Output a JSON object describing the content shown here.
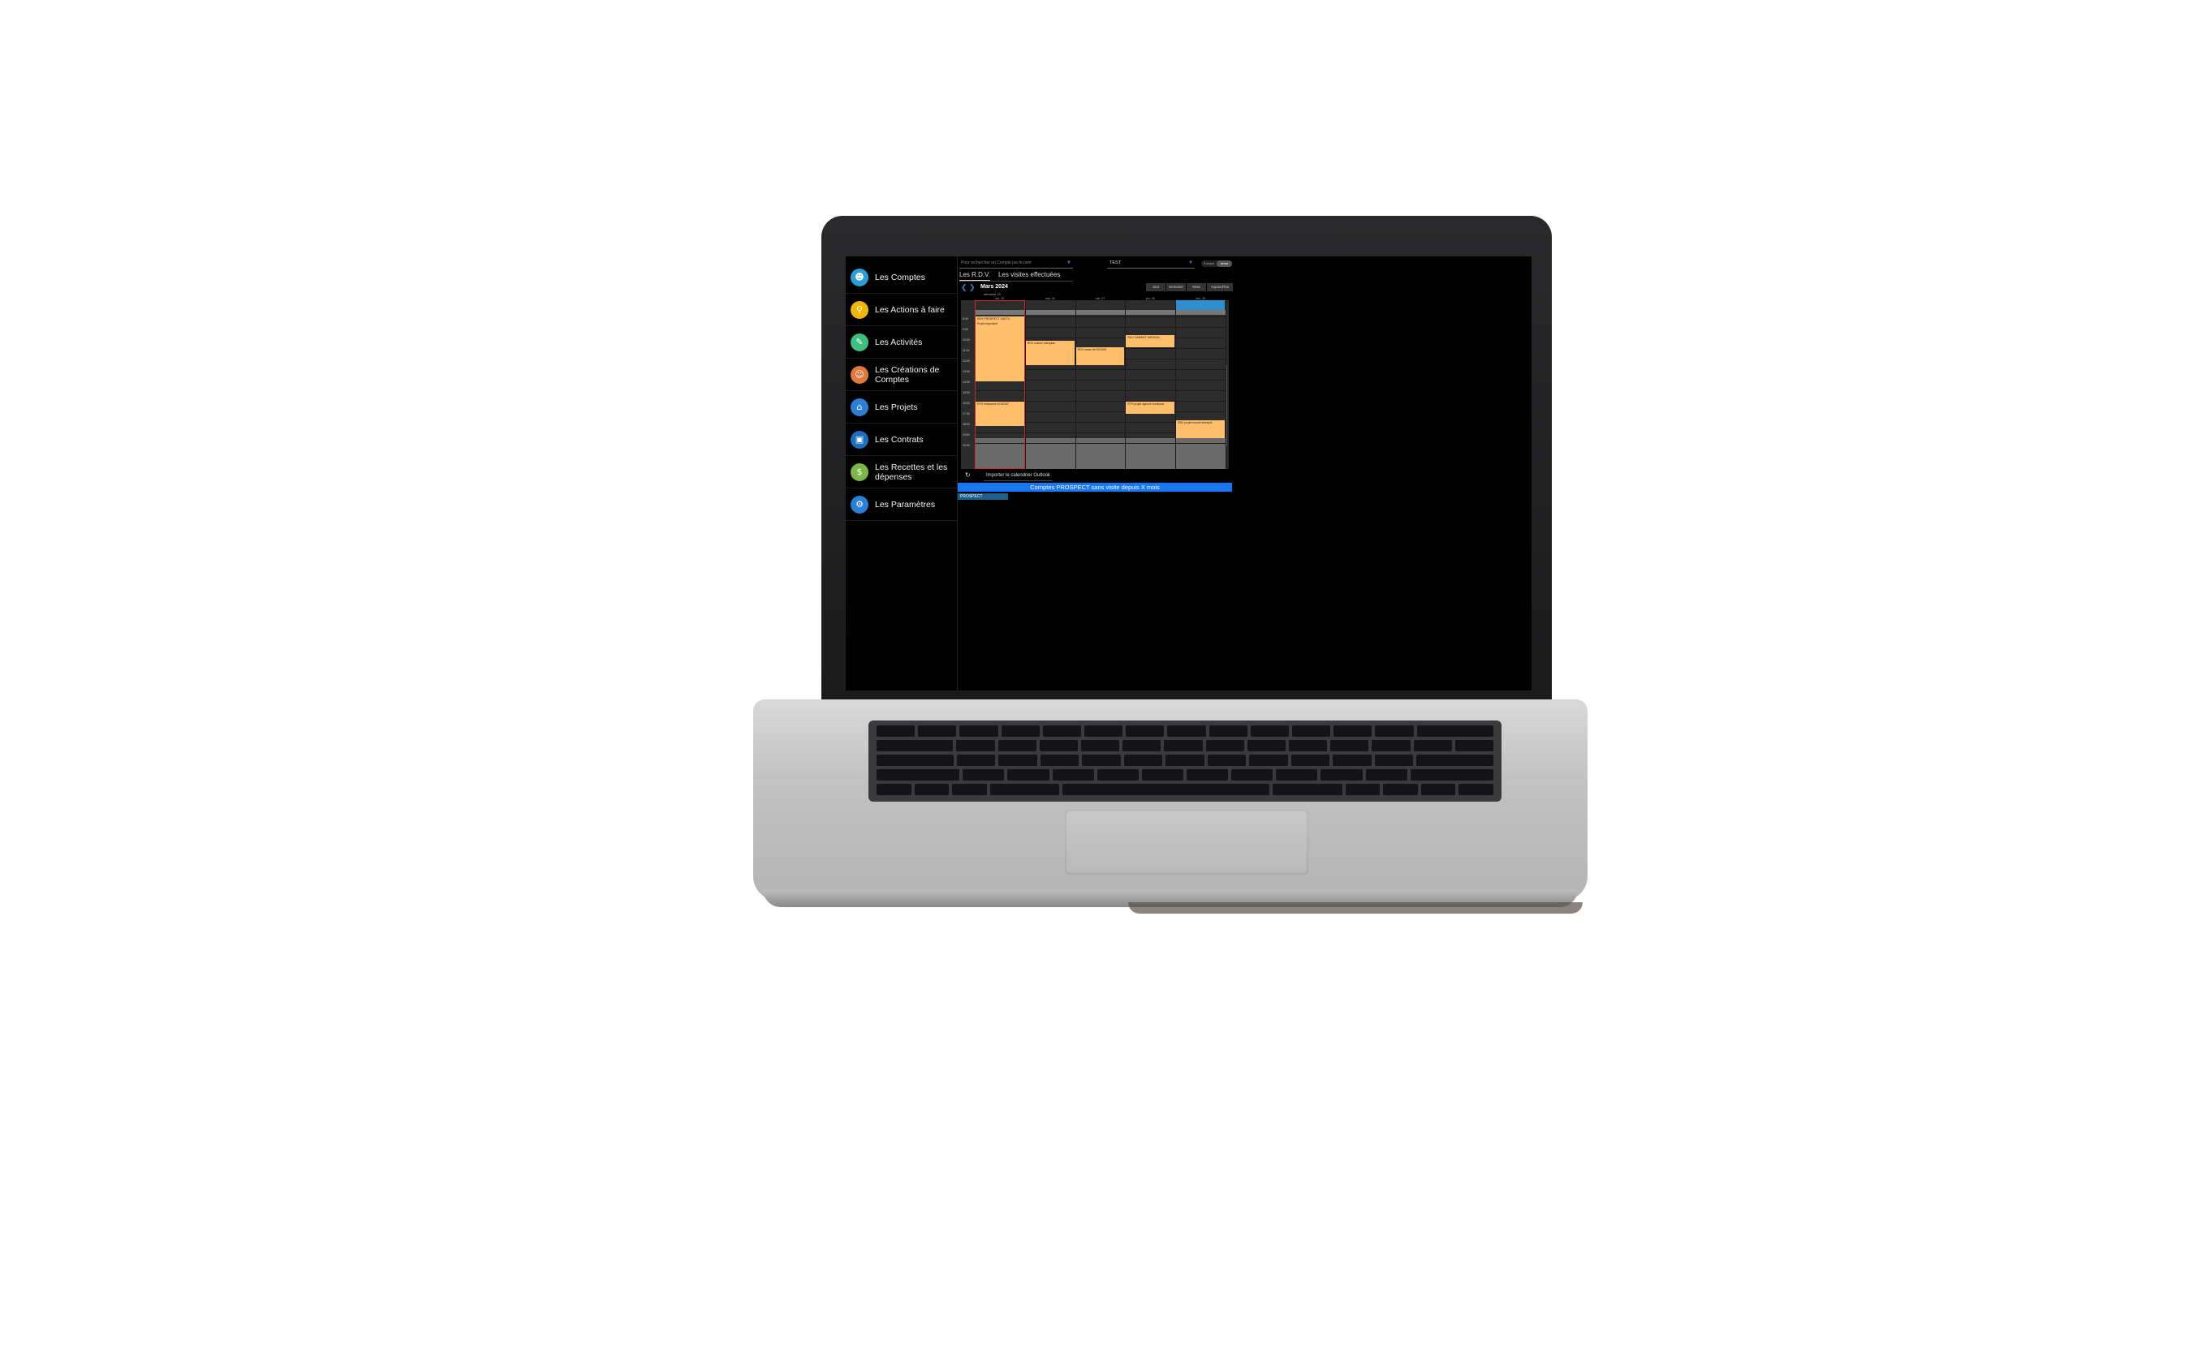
{
  "sidebar": {
    "items": [
      {
        "label": "Les Comptes",
        "icon": "people-icon",
        "color": "#2a9fd6"
      },
      {
        "label": "Les Actions à faire",
        "icon": "search-icon",
        "color": "#f2b705"
      },
      {
        "label": "Les Activités",
        "icon": "note-icon",
        "color": "#3fbf7f"
      },
      {
        "label": "Les Créations de Comptes",
        "icon": "user-icon",
        "color": "#e07a3b"
      },
      {
        "label": "Les Projets",
        "icon": "home-icon",
        "color": "#2a7fd6"
      },
      {
        "label": "Les Contrats",
        "icon": "folder-icon",
        "color": "#1c6fbf"
      },
      {
        "label": "Les Recettes et les dépenses",
        "icon": "money-icon",
        "color": "#7ab648"
      },
      {
        "label": "Les Paramètres",
        "icon": "gear-icon",
        "color": "#2a7fd6"
      }
    ]
  },
  "search": {
    "placeholder": "Pour rechercher un Compte par le nom"
  },
  "account_select": {
    "value": "TEST"
  },
  "toggle": {
    "left": "Europe",
    "right": "Amer"
  },
  "tabs": [
    {
      "label": "Les R.D.V."
    },
    {
      "label": "Les visites effectuées"
    }
  ],
  "calendar": {
    "month": "Mars 2024",
    "week": "semaine 13",
    "views": [
      "Jour",
      "Semaine",
      "Mois",
      "Aujourd'hui"
    ],
    "days": [
      "lun. 25",
      "mar. 26",
      "mer. 27",
      "jeu. 28",
      "ven. 29"
    ],
    "hours": [
      "8:00",
      "9:00",
      "10:00",
      "11:00",
      "12:00",
      "13:00",
      "14:00",
      "15:00",
      "16:00",
      "17:00",
      "18:00",
      "19:00",
      "20:00"
    ],
    "events": [
      {
        "title": "RDV PROSPECT SAETIL",
        "day": 0
      },
      {
        "title": "Projet important",
        "day": 0
      },
      {
        "title": "RDV culture marquise",
        "day": 1
      },
      {
        "title": "RDV maire de DESSIS",
        "day": 2
      },
      {
        "title": "RDV CABINET MEDICAL",
        "day": 3
      },
      {
        "title": "RTH entreprise KOURAT",
        "day": 0
      },
      {
        "title": "RTH projet agence bordeaux",
        "day": 3
      },
      {
        "title": "RDV projet nouvel entrepôt",
        "day": 4
      }
    ]
  },
  "import": {
    "label": "Importer le calendrier Outlook"
  },
  "banner": {
    "title": "Comptes PROSPECT sans visite depuis X mois"
  },
  "prospect_tag": {
    "label": "PROSPECT"
  },
  "colors": {
    "event": "#ffbe6a",
    "banner": "#1877f2",
    "today_border": "#d12a2a"
  }
}
